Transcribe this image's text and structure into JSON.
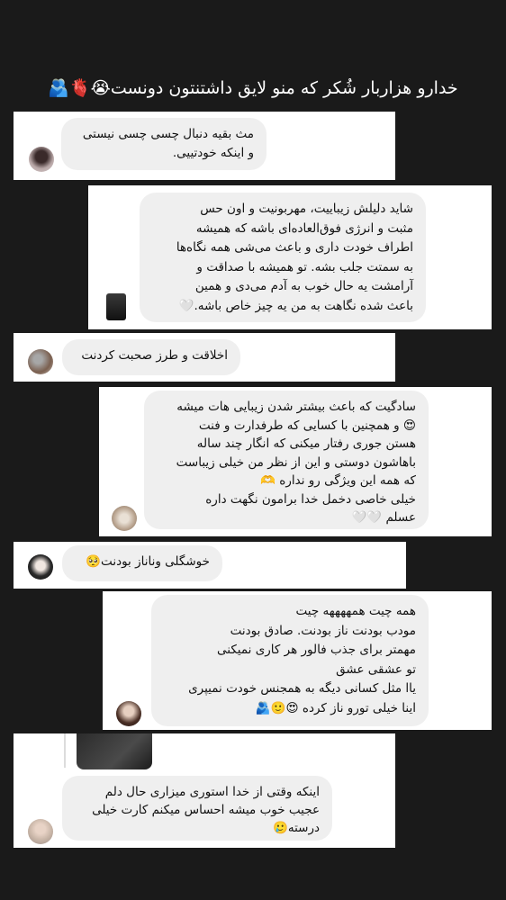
{
  "header": {
    "title": "خدارو هزاربار شُکر که منو لایق داشتنتون دونست😭🫀🫂"
  },
  "comments": [
    {
      "lines": [
        "مث بقیه دنبال چسی چسی نیستی",
        "و اینکه خودتییی."
      ]
    },
    {
      "lines": [
        "شاید دلیلش زیباییت، مهربونیت و اون حس",
        "مثبت و انرژی فوق‌العاده‌ای باشه که همیشه",
        "اطراف خودت داری و باعث می‌شی همه نگاه‌ها",
        "به سمتت جلب بشه. تو همیشه با صداقت و",
        "آرامشت یه حال خوب به آدم می‌دی و همین",
        "باعث شده نگاهت به من یه چیز خاص باشه.🤍"
      ]
    },
    {
      "lines": [
        "اخلاقت و طرز صحبت کردنت"
      ]
    },
    {
      "lines": [
        "سادگیت که باعث بیشتر شدن زیبایی هات میشه",
        "😍 و همچنین با کسایی که طرفدارت و فنت",
        "هستن جوری رفتار میکنی که انگار چند ساله",
        "باهاشون دوستی و این از نظر من خیلی زیباست",
        "که همه این ویژگی رو نداره 🫶",
        "خیلی خاصی دخمل خدا برامون نگهت داره",
        "عسلم 🤍🤍"
      ]
    },
    {
      "lines": [
        "خوشگلی وناناز بودنت🥺"
      ]
    },
    {
      "lines": [
        "همه چیت همههههه چیت",
        "مودب بودنت  ناز بودنت. صادق بودنت",
        "مهمتر برای جذب فالور هر کاری نمیکنی",
        "تو عشقی عشق",
        "یاا مثل کسانی دیگه به همجنس خودت نمیپری",
        "اینا خیلی تورو ناز کرده 😍🙂🫂"
      ]
    },
    {
      "lines": [
        "اینکه وقتی از خدا استوری میزاری حال دلم",
        "عجیب خوب میشه احساس میکنم کارت خیلی",
        "درسته🥲"
      ]
    }
  ]
}
